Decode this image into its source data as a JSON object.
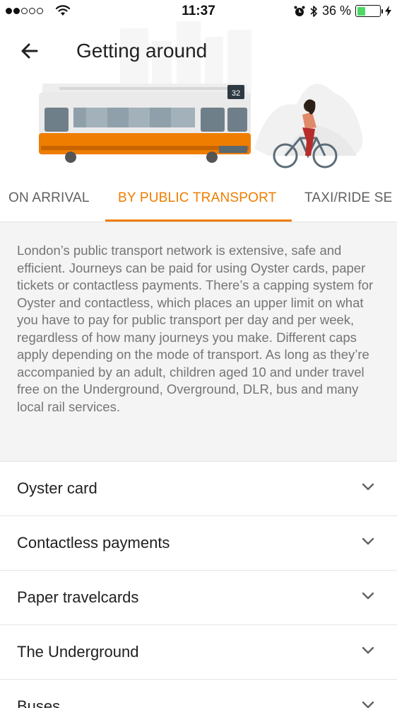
{
  "status_bar": {
    "time": "11:37",
    "battery_percent": "36 %",
    "battery_level": 0.36,
    "signal_bars_filled": 2,
    "signal_bars_total": 5
  },
  "header": {
    "title": "Getting around",
    "back_icon": "arrow-left-icon"
  },
  "illustration": {
    "tram_number": "32"
  },
  "tabs": [
    {
      "label": "ON ARRIVAL",
      "active": false
    },
    {
      "label": "BY PUBLIC TRANSPORT",
      "active": true
    },
    {
      "label": "TAXI/RIDE SE",
      "active": false
    }
  ],
  "intro": {
    "text": "London’s public transport network is extensive, safe and efficient. Journeys can be paid for using Oyster cards, paper tickets or contactless payments. There’s a capping system for Oyster and contactless, which places an upper limit on what you have to pay for public transport per day and per week, regardless of how many journeys you make. Different caps apply depending on the mode of transport. As long as they’re accompanied by an adult, children aged 10 and under travel free on the Underground, Overground, DLR, bus and many local rail services."
  },
  "sections": [
    {
      "label": "Oyster card",
      "icon": "chevron-down-icon"
    },
    {
      "label": "Contactless payments",
      "icon": "chevron-down-icon"
    },
    {
      "label": "Paper travelcards",
      "icon": "chevron-down-icon"
    },
    {
      "label": "The Underground",
      "icon": "chevron-down-icon"
    },
    {
      "label": "Buses",
      "icon": "chevron-down-icon"
    }
  ],
  "colors": {
    "accent": "#ef7d00",
    "intro_bg": "#f4f4f4",
    "battery_fill": "#4cd964"
  }
}
